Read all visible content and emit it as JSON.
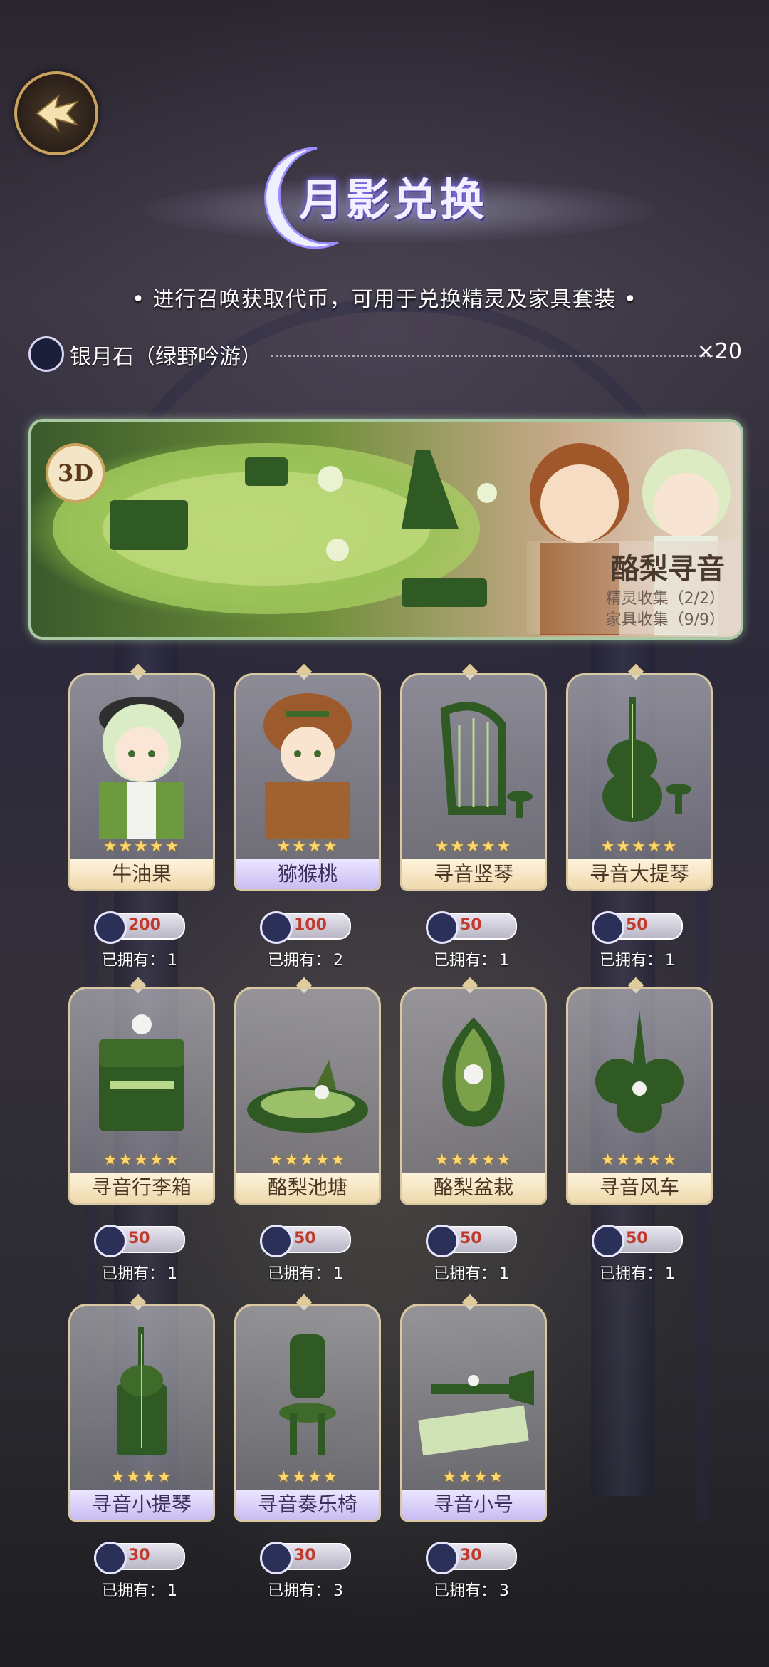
{
  "header": {
    "title": "月影兑换",
    "subtitle": "• 进行召唤获取代币，可用于兑换精灵及家具套装 •"
  },
  "currency": {
    "name": "银月石（绿野吟游）",
    "quantity": "×20"
  },
  "banner": {
    "badge": "3D",
    "set_name": "酪梨寻音",
    "spirit_collect": "精灵收集（2/2）",
    "furniture_collect": "家具收集（9/9）"
  },
  "owned_label": "已拥有：",
  "items": [
    {
      "name": "牛油果",
      "stars": "★★★★★",
      "price": "200",
      "owned": "1"
    },
    {
      "name": "猕猴桃",
      "stars": "★★★★",
      "price": "100",
      "owned": "2"
    },
    {
      "name": "寻音竖琴",
      "stars": "★★★★★",
      "price": "50",
      "owned": "1"
    },
    {
      "name": "寻音大提琴",
      "stars": "★★★★★",
      "price": "50",
      "owned": "1"
    },
    {
      "name": "寻音行李箱",
      "stars": "★★★★★",
      "price": "50",
      "owned": "1"
    },
    {
      "name": "酪梨池塘",
      "stars": "★★★★★",
      "price": "50",
      "owned": "1"
    },
    {
      "name": "酪梨盆栽",
      "stars": "★★★★★",
      "price": "50",
      "owned": "1"
    },
    {
      "name": "寻音风车",
      "stars": "★★★★★",
      "price": "50",
      "owned": "1"
    },
    {
      "name": "寻音小提琴",
      "stars": "★★★★",
      "price": "30",
      "owned": "1"
    },
    {
      "name": "寻音奏乐椅",
      "stars": "★★★★",
      "price": "30",
      "owned": "3"
    },
    {
      "name": "寻音小号",
      "stars": "★★★★",
      "price": "30",
      "owned": "3"
    }
  ],
  "colors": {
    "gold": "#c9a25f",
    "price_red": "#c0392b",
    "leaf_green": "#3f6b2a"
  }
}
